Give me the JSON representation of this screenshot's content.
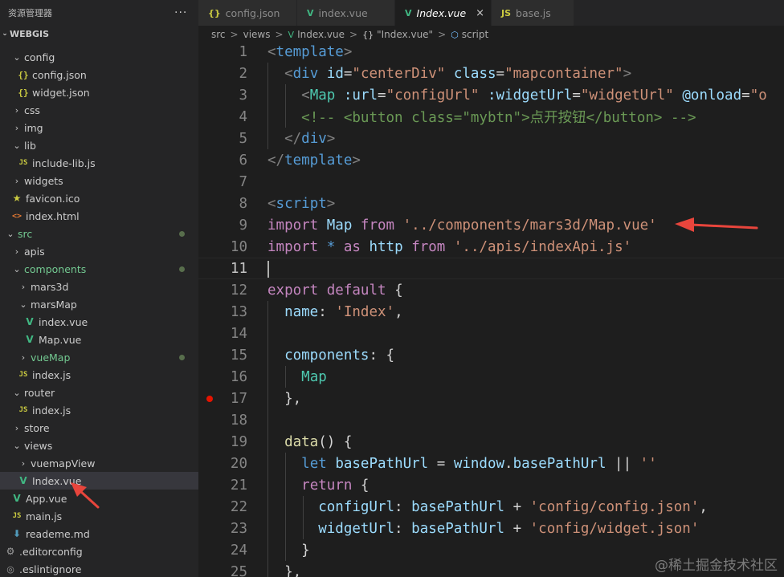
{
  "sidebar": {
    "title": "资源管理器",
    "more_label": "···",
    "workspace": "WEBGIS",
    "items": [
      {
        "label": "config",
        "kind": "folder-open",
        "depth": 1
      },
      {
        "label": "config.json",
        "kind": "json",
        "depth": 2
      },
      {
        "label": "widget.json",
        "kind": "json",
        "depth": 2
      },
      {
        "label": "css",
        "kind": "folder",
        "depth": 1
      },
      {
        "label": "img",
        "kind": "folder",
        "depth": 1
      },
      {
        "label": "lib",
        "kind": "folder-open",
        "depth": 1
      },
      {
        "label": "include-lib.js",
        "kind": "js",
        "depth": 2
      },
      {
        "label": "widgets",
        "kind": "folder",
        "depth": 1
      },
      {
        "label": "favicon.ico",
        "kind": "star",
        "depth": 1
      },
      {
        "label": "index.html",
        "kind": "html",
        "depth": 1
      },
      {
        "label": "src",
        "kind": "folder-open",
        "depth": 0,
        "modified": true
      },
      {
        "label": "apis",
        "kind": "folder",
        "depth": 1
      },
      {
        "label": "components",
        "kind": "folder-open",
        "depth": 1,
        "modified": true
      },
      {
        "label": "mars3d",
        "kind": "folder",
        "depth": 2
      },
      {
        "label": "marsMap",
        "kind": "folder-open",
        "depth": 2
      },
      {
        "label": "index.vue",
        "kind": "vue",
        "depth": 3
      },
      {
        "label": "Map.vue",
        "kind": "vue",
        "depth": 3
      },
      {
        "label": "vueMap",
        "kind": "folder",
        "depth": 2,
        "modified": true
      },
      {
        "label": "index.js",
        "kind": "js",
        "depth": 2
      },
      {
        "label": "router",
        "kind": "folder-open",
        "depth": 1
      },
      {
        "label": "index.js",
        "kind": "js",
        "depth": 2
      },
      {
        "label": "store",
        "kind": "folder",
        "depth": 1
      },
      {
        "label": "views",
        "kind": "folder-open",
        "depth": 1
      },
      {
        "label": "vuemapView",
        "kind": "folder",
        "depth": 2
      },
      {
        "label": "Index.vue",
        "kind": "vue",
        "depth": 2,
        "selected": true
      },
      {
        "label": "App.vue",
        "kind": "vue",
        "depth": 1
      },
      {
        "label": "main.js",
        "kind": "js",
        "depth": 1
      },
      {
        "label": "reademe.md",
        "kind": "md",
        "depth": 1
      },
      {
        "label": ".editorconfig",
        "kind": "gear",
        "depth": 0
      },
      {
        "label": ".eslintignore",
        "kind": "lint",
        "depth": 0
      }
    ]
  },
  "tabs": [
    {
      "label": "config.json",
      "icon": "{}",
      "kind": "json"
    },
    {
      "label": "index.vue",
      "icon": "V",
      "kind": "vue"
    },
    {
      "label": "Index.vue",
      "icon": "V",
      "kind": "vue",
      "active": true,
      "close": "×"
    },
    {
      "label": "base.js",
      "icon": "JS",
      "kind": "js"
    }
  ],
  "breadcrumb": {
    "parts": [
      "src",
      "views",
      "Index.vue",
      "\"Index.vue\"",
      "script"
    ],
    "separator": ">"
  },
  "editor": {
    "line_numbers": [
      "1",
      "2",
      "3",
      "4",
      "5",
      "6",
      "7",
      "8",
      "9",
      "10",
      "11",
      "12",
      "13",
      "14",
      "15",
      "16",
      "17",
      "18",
      "19",
      "20",
      "21",
      "22",
      "23",
      "24",
      "25"
    ],
    "current_line": "11",
    "breakpoint_line": "17",
    "lines": [
      [
        [
          "tagb",
          "<"
        ],
        [
          "tag",
          "template"
        ],
        [
          "tagb",
          ">"
        ]
      ],
      [
        [
          "punc",
          "  "
        ],
        [
          "tagb",
          "<"
        ],
        [
          "tag",
          "div"
        ],
        [
          "punc",
          " "
        ],
        [
          "attr",
          "id"
        ],
        [
          "punc",
          "="
        ],
        [
          "str",
          "\"centerDiv\""
        ],
        [
          "punc",
          " "
        ],
        [
          "attr",
          "class"
        ],
        [
          "punc",
          "="
        ],
        [
          "str",
          "\"mapcontainer\""
        ],
        [
          "tagb",
          ">"
        ]
      ],
      [
        [
          "punc",
          "    "
        ],
        [
          "tagb",
          "<"
        ],
        [
          "cmp",
          "Map"
        ],
        [
          "punc",
          " "
        ],
        [
          "attr",
          ":url"
        ],
        [
          "punc",
          "="
        ],
        [
          "str",
          "\"configUrl\""
        ],
        [
          "punc",
          " "
        ],
        [
          "attr",
          ":widgetUrl"
        ],
        [
          "punc",
          "="
        ],
        [
          "str",
          "\"widgetUrl\""
        ],
        [
          "punc",
          " "
        ],
        [
          "attr",
          "@onload"
        ],
        [
          "punc",
          "="
        ],
        [
          "str",
          "\"o"
        ]
      ],
      [
        [
          "punc",
          "    "
        ],
        [
          "cm",
          "<!-- <button class=\"mybtn\">点开按钮</button> -->"
        ]
      ],
      [
        [
          "punc",
          "  "
        ],
        [
          "tagb",
          "</"
        ],
        [
          "tag",
          "div"
        ],
        [
          "tagb",
          ">"
        ]
      ],
      [
        [
          "tagb",
          "</"
        ],
        [
          "tag",
          "template"
        ],
        [
          "tagb",
          ">"
        ]
      ],
      [],
      [
        [
          "tagb",
          "<"
        ],
        [
          "tag",
          "script"
        ],
        [
          "tagb",
          ">"
        ]
      ],
      [
        [
          "kw2",
          "import"
        ],
        [
          "punc",
          " "
        ],
        [
          "var",
          "Map"
        ],
        [
          "punc",
          " "
        ],
        [
          "kw2",
          "from"
        ],
        [
          "punc",
          " "
        ],
        [
          "str",
          "'../components/mars3d/Map.vue'"
        ]
      ],
      [
        [
          "kw2",
          "import"
        ],
        [
          "punc",
          " "
        ],
        [
          "kw",
          "*"
        ],
        [
          "punc",
          " "
        ],
        [
          "kw2",
          "as"
        ],
        [
          "punc",
          " "
        ],
        [
          "var",
          "http"
        ],
        [
          "punc",
          " "
        ],
        [
          "kw2",
          "from"
        ],
        [
          "punc",
          " "
        ],
        [
          "str",
          "'../apis/indexApi.js'"
        ]
      ],
      [],
      [
        [
          "kw2",
          "export"
        ],
        [
          "punc",
          " "
        ],
        [
          "kw2",
          "default"
        ],
        [
          "punc",
          " {"
        ]
      ],
      [
        [
          "punc",
          "  "
        ],
        [
          "prop",
          "name"
        ],
        [
          "punc",
          ": "
        ],
        [
          "str",
          "'Index'"
        ],
        [
          "punc",
          ","
        ]
      ],
      [],
      [
        [
          "punc",
          "  "
        ],
        [
          "prop",
          "components"
        ],
        [
          "punc",
          ": {"
        ]
      ],
      [
        [
          "punc",
          "    "
        ],
        [
          "cmp",
          "Map"
        ]
      ],
      [
        [
          "punc",
          "  },"
        ]
      ],
      [],
      [
        [
          "punc",
          "  "
        ],
        [
          "fn",
          "data"
        ],
        [
          "punc",
          "() {"
        ]
      ],
      [
        [
          "punc",
          "    "
        ],
        [
          "kw",
          "let"
        ],
        [
          "punc",
          " "
        ],
        [
          "var",
          "basePathUrl"
        ],
        [
          "punc",
          " = "
        ],
        [
          "var",
          "window"
        ],
        [
          "punc",
          "."
        ],
        [
          "var",
          "basePathUrl"
        ],
        [
          "punc",
          " || "
        ],
        [
          "str",
          "''"
        ]
      ],
      [
        [
          "punc",
          "    "
        ],
        [
          "kw2",
          "return"
        ],
        [
          "punc",
          " {"
        ]
      ],
      [
        [
          "punc",
          "      "
        ],
        [
          "prop",
          "configUrl"
        ],
        [
          "punc",
          ": "
        ],
        [
          "var",
          "basePathUrl"
        ],
        [
          "punc",
          " + "
        ],
        [
          "str",
          "'config/config.json'"
        ],
        [
          "punc",
          ","
        ]
      ],
      [
        [
          "punc",
          "      "
        ],
        [
          "prop",
          "widgetUrl"
        ],
        [
          "punc",
          ": "
        ],
        [
          "var",
          "basePathUrl"
        ],
        [
          "punc",
          " + "
        ],
        [
          "str",
          "'config/widget.json'"
        ]
      ],
      [
        [
          "punc",
          "    }"
        ]
      ],
      [
        [
          "punc",
          "  },"
        ]
      ]
    ]
  },
  "watermark": "@稀土掘金技术社区",
  "colors": {
    "accent_arrow": "#e8453c",
    "vue": "#41b883",
    "js": "#cbcb41"
  }
}
